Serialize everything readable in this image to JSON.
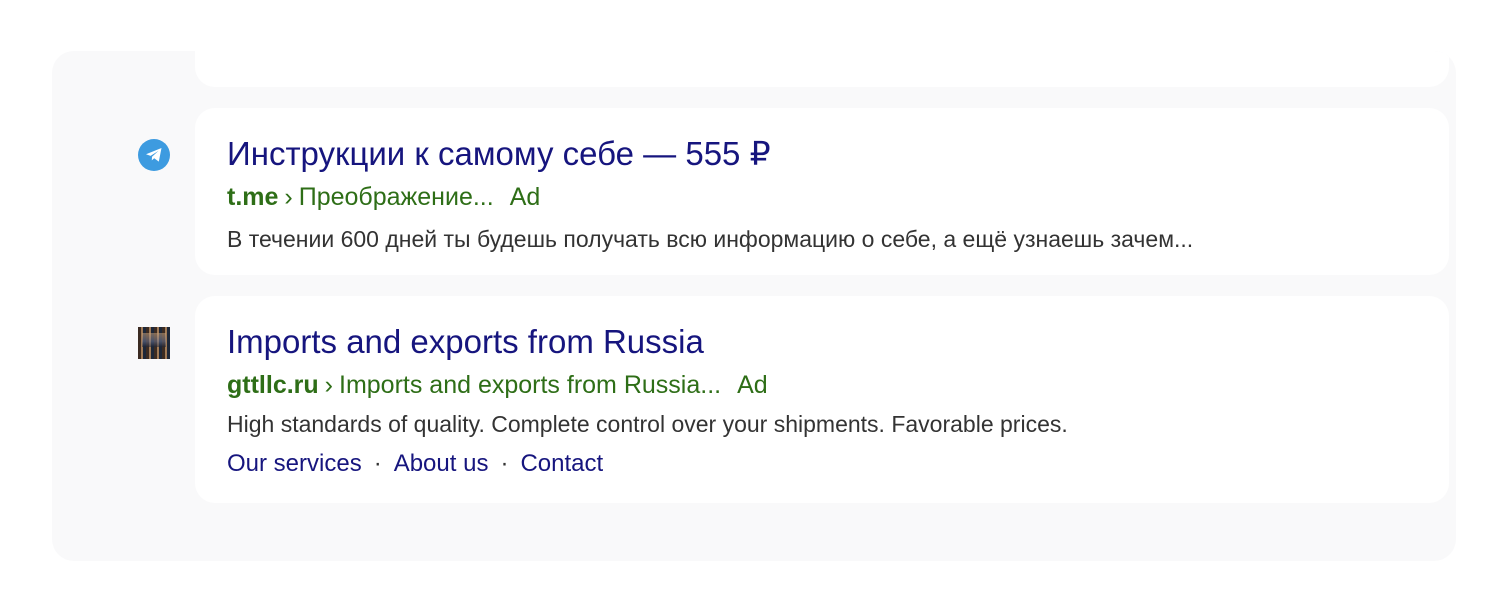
{
  "results": [
    {
      "favicon": "telegram-icon",
      "title": "Инструкции к самому себе — 555 ₽",
      "domain": "t.me",
      "separator": "›",
      "path": "Преображение...",
      "ad_label": "Ad",
      "snippet": "В течении 600 дней ты будешь получать всю информацию о себе, а ещё узнаешь зачем..."
    },
    {
      "favicon": "site-thumbnail-icon",
      "title": "Imports and exports from Russia",
      "domain": "gttllc.ru",
      "separator": "›",
      "path": "Imports and exports from Russia...",
      "ad_label": "Ad",
      "snippet": "High standards of quality. Complete control over your shipments. Favorable prices.",
      "sitelinks": [
        "Our services",
        "About us",
        "Contact"
      ],
      "sitelink_separator": "·"
    }
  ],
  "colors": {
    "title": "#16157e",
    "url": "#2e6e17",
    "snippet": "#333333",
    "panel_bg": "#f9f9fa",
    "telegram": "#3d9be0"
  }
}
